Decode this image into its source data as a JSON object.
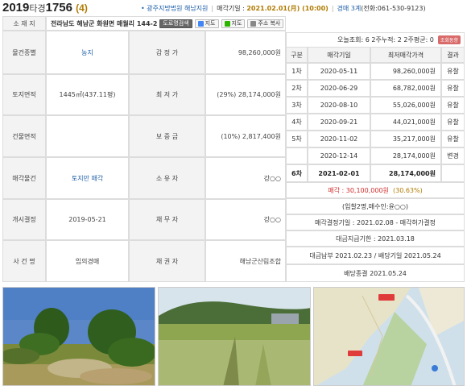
{
  "header": {
    "case_year": "2019",
    "case_type": "타경",
    "case_number": "1756",
    "case_count": "(4)",
    "court": "광주지방법원 해남지원",
    "sale_date_label": "매각기일 :",
    "sale_date": "2021.02.01(月) (10:00)",
    "dept": "경매 3계",
    "phone": "(전화:061-530-9123)"
  },
  "address_row": {
    "label": "소 재 지",
    "address": "전라남도 해남군 화원면 매월리 144-2",
    "btn_road": "도로명검색",
    "btn_map1": "지도",
    "btn_map2": "지도",
    "btn_copy": "주소 복사"
  },
  "details": [
    {
      "label": "물건종별",
      "value": "농지",
      "label2": "감 정 가",
      "value2": "98,260,000원"
    },
    {
      "label": "토지면적",
      "value": "1445㎡(437.11평)",
      "label2": "최 저 가",
      "value2": "(29%) 28,174,000원"
    },
    {
      "label": "건물면적",
      "value": "",
      "label2": "보 증 금",
      "value2": "(10%) 2,817,400원"
    },
    {
      "label": "매각물건",
      "value": "토지만 매각",
      "label2": "소 유 자",
      "value2": "강○○"
    },
    {
      "label": "개시결정",
      "value": "2019-05-21",
      "label2": "채 무 자",
      "value2": "강○○"
    },
    {
      "label": "사 건 명",
      "value": "임의경매",
      "label2": "채 권 자",
      "value2": "해남군산림조합"
    }
  ],
  "history": {
    "views": "오늘조회: 6  2주누적: 2  2주평균: 0",
    "detail_btn": "조회동향",
    "headers": [
      "구분",
      "매각기일",
      "최저매각가격",
      "결과"
    ],
    "rows": [
      {
        "round": "1차",
        "date": "2020-05-11",
        "price": "98,260,000원",
        "result": "유찰"
      },
      {
        "round": "2차",
        "date": "2020-06-29",
        "price": "68,782,000원",
        "result": "유찰"
      },
      {
        "round": "3차",
        "date": "2020-08-10",
        "price": "55,026,000원",
        "result": "유찰"
      },
      {
        "round": "4차",
        "date": "2020-09-21",
        "price": "44,021,000원",
        "result": "유찰"
      },
      {
        "round": "5차",
        "date": "2020-11-02",
        "price": "35,217,000원",
        "result": "유찰"
      },
      {
        "round": "",
        "date": "2020-12-14",
        "price": "28,174,000원",
        "result": "변경"
      },
      {
        "round": "6차",
        "date": "2021-02-01",
        "price": "28,174,000원",
        "result": ""
      }
    ],
    "sale_price_label": "매각 : 30,100,000원",
    "sale_price_pct": "(30.63%)",
    "bidders": "(입찰2명,매수인:윤○○)",
    "decision": "매각결정기일 : 2021.02.08 - 매각허가결정",
    "payment_deadline": "대금지급기한 : 2021.03.18",
    "payment": "대금납부 2021.02.23 / 배당기일 2021.05.24",
    "dividend": "배당종결 2021.05.24"
  },
  "photos": [
    "trees-photo",
    "field-photo",
    "map-photo"
  ]
}
